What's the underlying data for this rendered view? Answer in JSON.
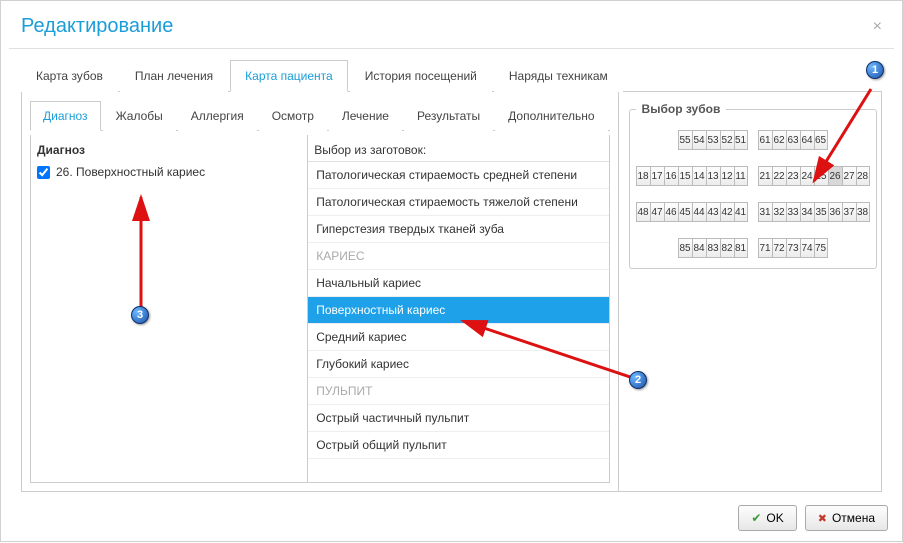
{
  "title": "Редактирование",
  "tabs": {
    "t0": "Карта зубов",
    "t1": "План лечения",
    "t2": "Карта пациента",
    "t3": "История посещений",
    "t4": "Наряды техникам"
  },
  "subtabs": {
    "s0": "Диагноз",
    "s1": "Жалобы",
    "s2": "Аллергия",
    "s3": "Осмотр",
    "s4": "Лечение",
    "s5": "Результаты",
    "s6": "Дополнительно"
  },
  "diag": {
    "heading": "Диагноз",
    "item0": "26. Поверхностный кариес"
  },
  "templates": {
    "heading": "Выбор из заготовок:",
    "i0": "Патологическая стираемость средней степени",
    "i1": "Патологическая стираемость тяжелой степени",
    "i2": "Гиперстезия твердых тканей зуба",
    "g0": "КАРИЕС",
    "i3": "Начальный кариес",
    "i4": "Поверхностный кариес",
    "i5": "Средний кариес",
    "i6": "Глубокий кариес",
    "g1": "ПУЛЬПИТ",
    "i7": "Острый частичный пульпит",
    "i8": "Острый общий пульпит"
  },
  "teeth": {
    "legend": "Выбор зубов",
    "r1a": [
      "55",
      "54",
      "53",
      "52",
      "51"
    ],
    "r1b": [
      "61",
      "62",
      "63",
      "64",
      "65"
    ],
    "r2a": [
      "18",
      "17",
      "16",
      "15",
      "14",
      "13",
      "12",
      "11"
    ],
    "r2b": [
      "21",
      "22",
      "23",
      "24",
      "25",
      "26",
      "27",
      "28"
    ],
    "r3a": [
      "48",
      "47",
      "46",
      "45",
      "44",
      "43",
      "42",
      "41"
    ],
    "r3b": [
      "31",
      "32",
      "33",
      "34",
      "35",
      "36",
      "37",
      "38"
    ],
    "r4a": [
      "85",
      "84",
      "83",
      "82",
      "81"
    ],
    "r4b": [
      "71",
      "72",
      "73",
      "74",
      "75"
    ],
    "selected": "26"
  },
  "buttons": {
    "ok": "OK",
    "cancel": "Отмена"
  },
  "markers": {
    "m1": "1",
    "m2": "2",
    "m3": "3"
  }
}
